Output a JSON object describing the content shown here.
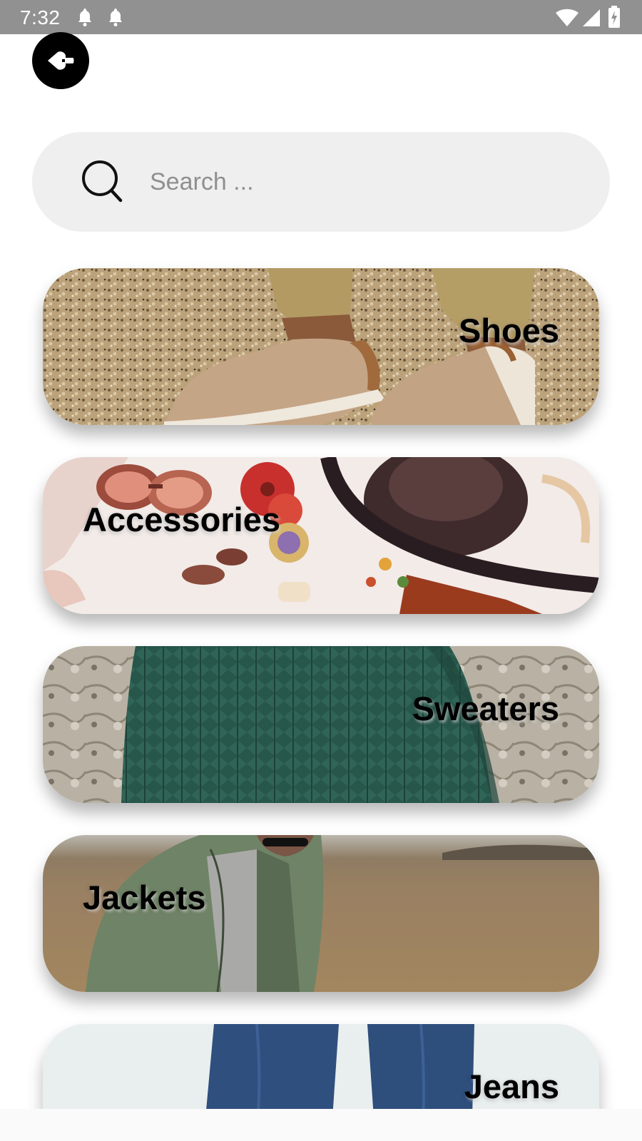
{
  "status_bar": {
    "time": "7:32",
    "icons": [
      "notification-bell-icon",
      "notification-bell-icon",
      "wifi-icon",
      "cell-signal-icon",
      "battery-charging-icon"
    ]
  },
  "header": {
    "back_icon": "back-arrow-icon"
  },
  "search": {
    "placeholder": "Search ...",
    "value": "",
    "icon": "search-icon"
  },
  "categories": [
    {
      "label": "Shoes",
      "label_align": "right",
      "image": "shoes-photo"
    },
    {
      "label": "Accessories",
      "label_align": "left",
      "image": "accessories-photo"
    },
    {
      "label": "Sweaters",
      "label_align": "right",
      "image": "sweaters-photo"
    },
    {
      "label": "Jackets",
      "label_align": "left",
      "image": "jackets-photo"
    },
    {
      "label": "Jeans",
      "label_align": "right",
      "image": "jeans-photo"
    }
  ],
  "colors": {
    "status_bar": "#919191",
    "search_bg": "#efefef",
    "placeholder": "#8f8f8f",
    "back_button": "#000000"
  }
}
